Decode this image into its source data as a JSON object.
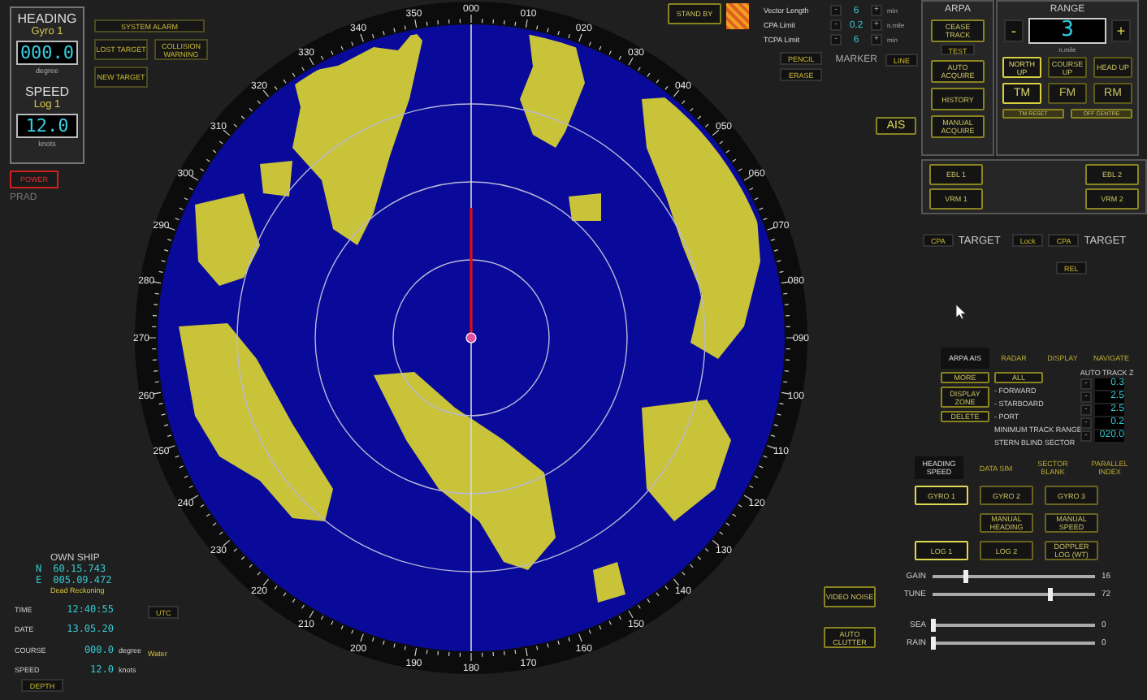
{
  "heading": {
    "label": "HEADING",
    "source": "Gyro 1",
    "value": "000.0",
    "unit": "degree"
  },
  "speed": {
    "label": "SPEED",
    "source": "Log 1",
    "value": "12.0",
    "unit": "knots"
  },
  "power": "POWER",
  "prad": "PRAD",
  "alarms": [
    "SYSTEM ALARM",
    "LOST TARGET",
    "COLLISION WARNING",
    "NEW TARGET"
  ],
  "own_ship": {
    "title": "OWN SHIP",
    "lat_prefix": "N",
    "lat": "60.15.743",
    "lon_prefix": "E",
    "lon": "005.09.472",
    "mode": "Dead Reckoning",
    "rows": [
      {
        "label": "TIME",
        "value": "12:40:55"
      },
      {
        "label": "DATE",
        "value": "13.05.20"
      },
      {
        "label": "COURSE",
        "value": "000.0",
        "unit": "degree"
      },
      {
        "label": "SPEED",
        "value": "12.0",
        "unit": "knots"
      }
    ],
    "utc": "UTC",
    "water": "Water",
    "depth": "DEPTH"
  },
  "radar": {
    "bearing_labels": [
      "000",
      "010",
      "020",
      "030",
      "040",
      "050",
      "060",
      "070",
      "080",
      "090",
      "100",
      "110",
      "120",
      "130",
      "140",
      "150",
      "160",
      "170",
      "180",
      "190",
      "200",
      "210",
      "220",
      "230",
      "240",
      "250",
      "260",
      "270",
      "280",
      "290",
      "300",
      "310",
      "320",
      "330",
      "340",
      "350"
    ]
  },
  "standby": "STAND BY",
  "limits": [
    {
      "label": "Vector Length",
      "dec": "-",
      "value": "6",
      "inc": "+",
      "unit": "min"
    },
    {
      "label": "CPA Limit",
      "dec": "-",
      "value": "0.2",
      "inc": "+",
      "unit": "n.mile"
    },
    {
      "label": "TCPA Limit",
      "dec": "-",
      "value": "6",
      "inc": "+",
      "unit": "min"
    }
  ],
  "pencil": "PENCIL",
  "erase": "ERASE",
  "marker": {
    "label": "MARKER",
    "button": "LINE"
  },
  "ais": "AIS",
  "arpa": {
    "title": "ARPA",
    "buttons": [
      {
        "label": "CEASE TRACK",
        "kind": "big"
      },
      {
        "label": "TEST",
        "kind": "small"
      },
      {
        "label": "AUTO ACQUIRE",
        "kind": "big"
      },
      {
        "label": "HISTORY",
        "kind": "big"
      },
      {
        "label": "MANUAL ACQUIRE",
        "kind": "big"
      }
    ]
  },
  "range": {
    "title": "RANGE",
    "dec": "-",
    "value": "3",
    "inc": "+",
    "unit": "n.mile",
    "orientation": [
      {
        "label": "NORTH UP",
        "selected": true
      },
      {
        "label": "COURSE UP",
        "selected": false
      },
      {
        "label": "HEAD UP",
        "selected": false
      }
    ],
    "motion": [
      {
        "label": "TM",
        "selected": true
      },
      {
        "label": "FM",
        "selected": false
      },
      {
        "label": "RM",
        "selected": false
      }
    ],
    "extra": [
      "TM RESET",
      "OFF CENTRE"
    ]
  },
  "lines": [
    "EBL 1",
    "EBL 2",
    "VRM 1",
    "VRM 2"
  ],
  "targets": [
    {
      "kind": "tag",
      "label": "CPA"
    },
    {
      "kind": "text",
      "label": "TARGET"
    },
    {
      "kind": "tag",
      "label": "Lock"
    },
    {
      "kind": "tag",
      "label": "CPA"
    },
    {
      "kind": "text",
      "label": "TARGET"
    }
  ],
  "rel": "REL",
  "menu_tabs": [
    {
      "label": "ARPA AIS",
      "selected": true
    },
    {
      "label": "RADAR",
      "selected": false
    },
    {
      "label": "DISPLAY",
      "selected": false
    },
    {
      "label": "NAVIGATE",
      "selected": false
    }
  ],
  "zone_buttons": [
    {
      "label": "MORE",
      "kind": "small"
    },
    {
      "label": "DISPLAY ZONE",
      "kind": "big"
    },
    {
      "label": "DELETE",
      "kind": "small"
    }
  ],
  "all_button": "ALL",
  "zone_options": [
    "- FORWARD",
    "- STARBOARD",
    "- PORT",
    "MINIMUM TRACK RANGE",
    "STERN BLIND SECTOR"
  ],
  "auto_track": {
    "title": "AUTO TRACK Z",
    "rows": [
      {
        "dec": "-",
        "value": "0.3"
      },
      {
        "dec": "-",
        "value": "2.5"
      },
      {
        "dec": "-",
        "value": "2.5"
      },
      {
        "dec": "-",
        "value": "0.2"
      },
      {
        "dec": "-",
        "value": "020.0"
      }
    ]
  },
  "sensor_tabs": [
    {
      "label": "HEADING SPEED",
      "selected": true
    },
    {
      "label": "DATA SIM",
      "selected": false
    },
    {
      "label": "SECTOR BLANK",
      "selected": false
    },
    {
      "label": "PARALLEL INDEX",
      "selected": false
    }
  ],
  "sensor_buttons": [
    {
      "kind": "button",
      "label": "GYRO 1",
      "selected": true
    },
    {
      "kind": "button",
      "label": "GYRO 2",
      "selected": false
    },
    {
      "kind": "button",
      "label": "GYRO 3",
      "selected": false
    },
    {
      "kind": "gap"
    },
    {
      "kind": "button",
      "label": "MANUAL HEADING",
      "selected": false
    },
    {
      "kind": "button",
      "label": "MANUAL SPEED",
      "selected": false
    },
    {
      "kind": "button",
      "label": "LOG 1",
      "selected": true
    },
    {
      "kind": "button",
      "label": "LOG 2",
      "selected": false
    },
    {
      "kind": "button",
      "label": "DOPPLER LOG (WT)",
      "selected": false
    }
  ],
  "clutter_buttons": [
    "VIDEO NOISE",
    "AUTO CLUTTER"
  ],
  "adjust": [
    {
      "label": "GAIN",
      "level": 0.2,
      "reading": "16"
    },
    {
      "label": "TUNE",
      "level": 0.72,
      "reading": "72"
    },
    {
      "label": "SEA",
      "level": 0,
      "reading": "0"
    },
    {
      "label": "RAIN",
      "level": 0,
      "reading": "0"
    }
  ]
}
